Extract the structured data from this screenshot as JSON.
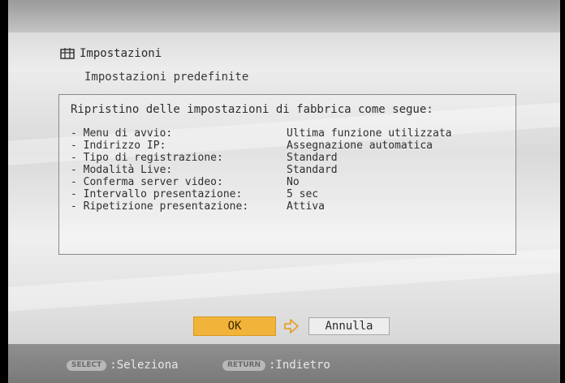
{
  "header": {
    "title": "Impostazioni",
    "icon": "settings-icon"
  },
  "subtitle": "Impostazioni predefinite",
  "panel": {
    "intro": "Ripristino delle impostazioni di fabbrica come segue:",
    "rows": [
      {
        "label": "- Menu di avvio:",
        "value": "Ultima funzione utilizzata"
      },
      {
        "label": "- Indirizzo IP:",
        "value": "Assegnazione automatica"
      },
      {
        "label": "- Tipo di registrazione:",
        "value": "Standard"
      },
      {
        "label": "- Modalità Live:",
        "value": "Standard"
      },
      {
        "label": "- Conferma server video:",
        "value": "No"
      },
      {
        "label": "- Intervallo presentazione:",
        "value": "5 sec"
      },
      {
        "label": "- Ripetizione presentazione:",
        "value": "Attiva"
      }
    ]
  },
  "buttons": {
    "ok": "OK",
    "cancel": "Annulla"
  },
  "footer": {
    "select_key": "SELECT",
    "select_label": ":Seleziona",
    "return_key": "RETURN",
    "return_label": ":Indietro"
  },
  "colors": {
    "focus": "#f2b33a",
    "footer": "#8a8a8a"
  }
}
